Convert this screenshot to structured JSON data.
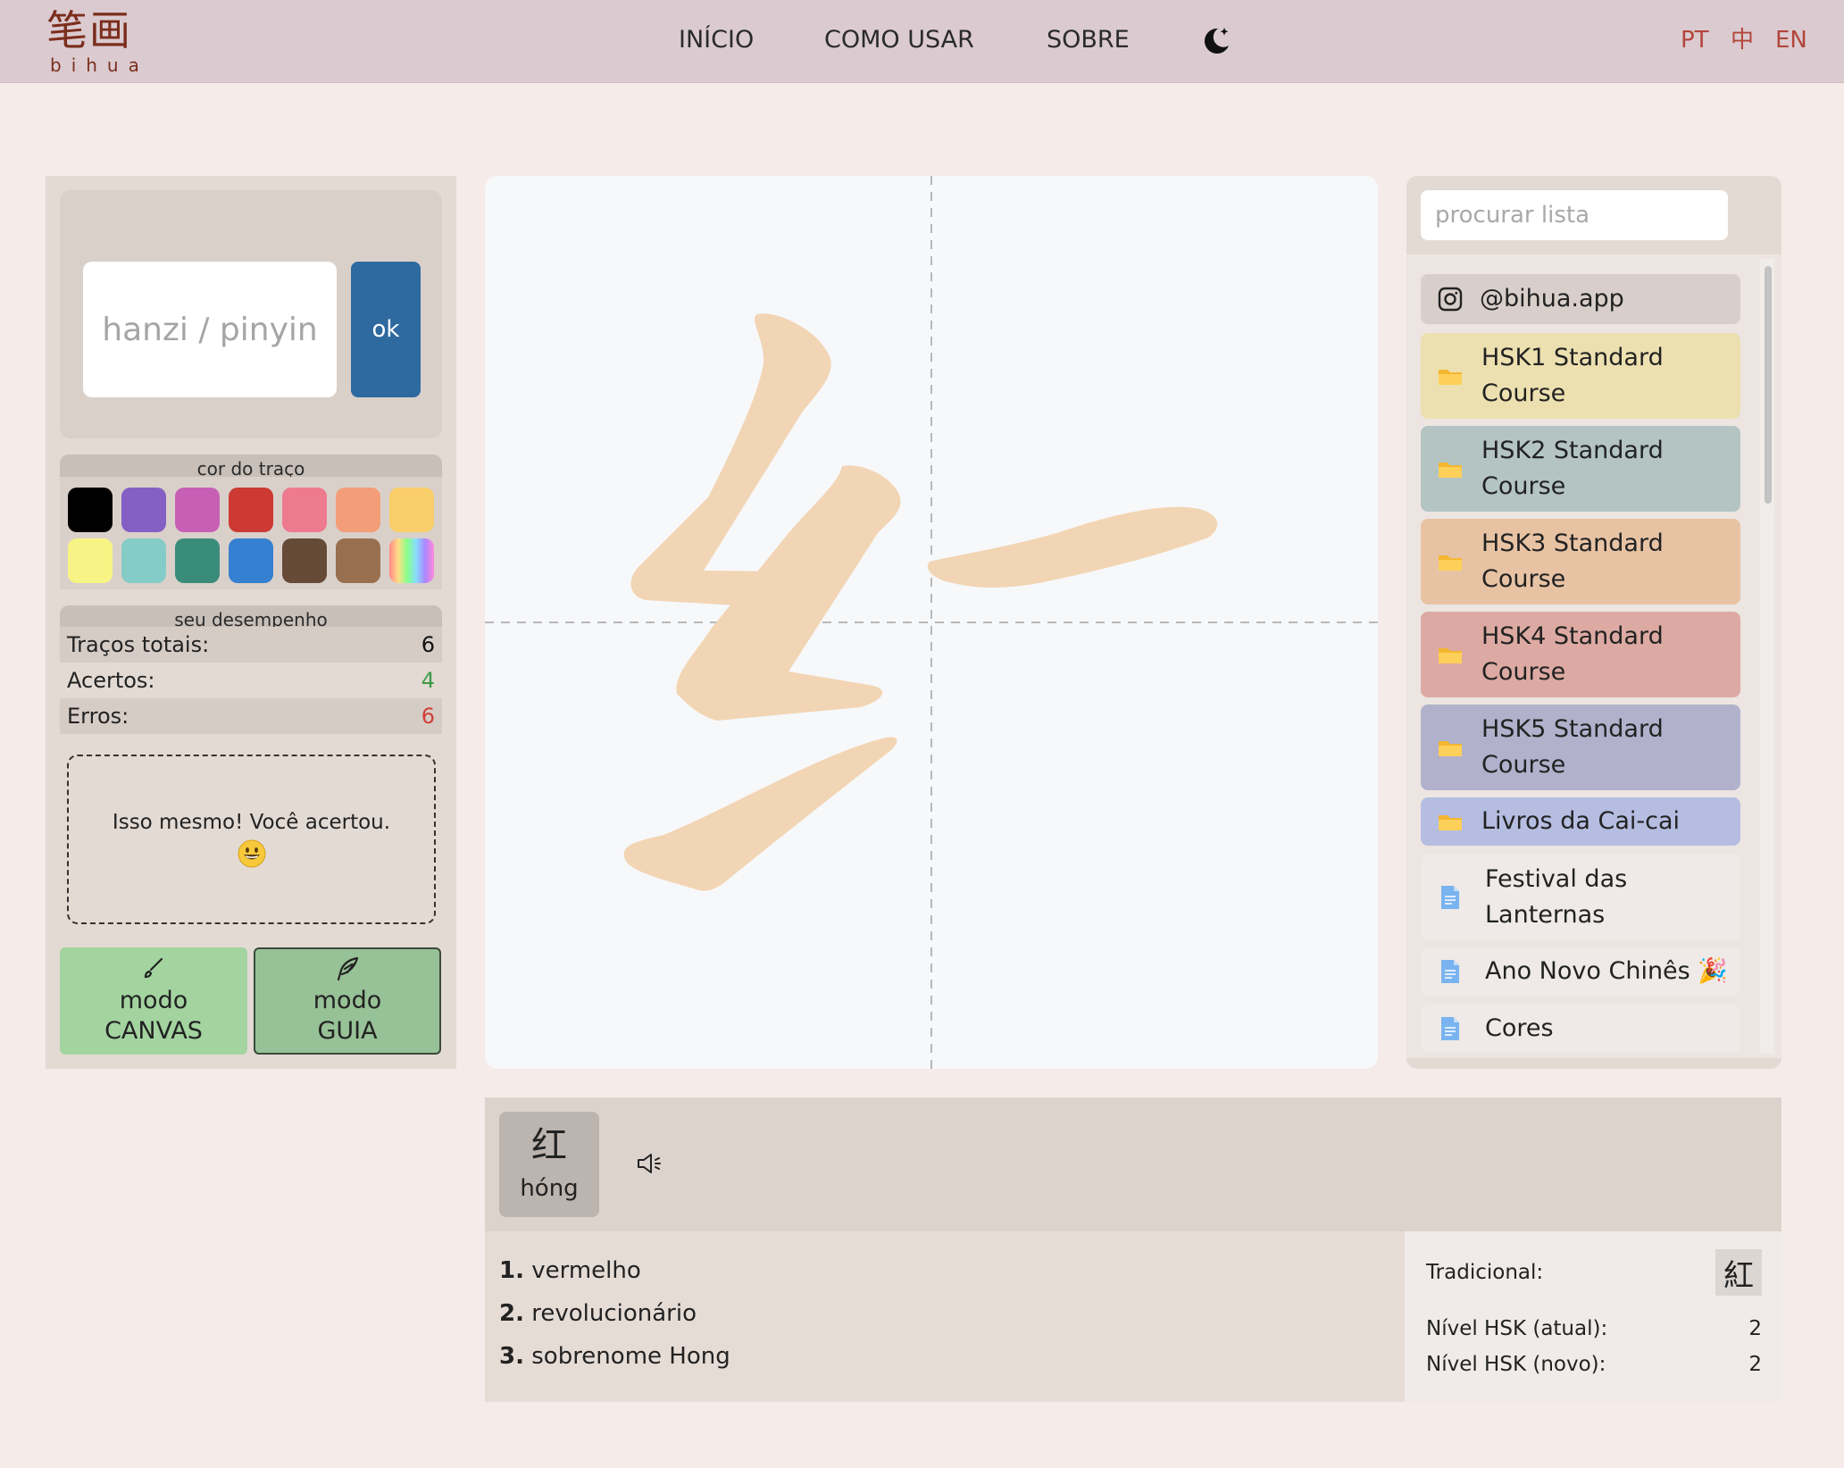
{
  "header": {
    "logo_cn": "笔画",
    "logo_en": "bihua",
    "nav": [
      "INÍCIO",
      "COMO USAR",
      "SOBRE"
    ],
    "languages": [
      "PT",
      "中",
      "EN"
    ],
    "accent_color": "#b2463a"
  },
  "left_panel": {
    "input_placeholder": "hanzi / pinyin",
    "ok_label": "ok",
    "stroke_color_title": "cor do traço",
    "swatches": [
      "#000000",
      "#8460c4",
      "#c760b5",
      "#cc3a33",
      "#ee7a90",
      "#f39e78",
      "#f8cd6a",
      "#f7f485",
      "#85cbc7",
      "#3a8c7a",
      "#3580d0",
      "#664a38",
      "#987050",
      "rainbow"
    ],
    "performance_title": "seu desempenho",
    "stats": {
      "total_label": "Traços totais:",
      "total_value": "6",
      "correct_label": "Acertos:",
      "correct_value": "4",
      "errors_label": "Erros:",
      "errors_value": "6"
    },
    "feedback": "Isso mesmo! Você acertou.",
    "mode_canvas": {
      "line1": "modo",
      "line2": "CANVAS"
    },
    "mode_guide": {
      "line1": "modo",
      "line2": "GUIA"
    }
  },
  "canvas": {
    "stroke_color": "#f2d5b4",
    "strokes_drawn": 4
  },
  "right_panel": {
    "search_placeholder": "procurar lista",
    "items": [
      {
        "label": "@bihua.app",
        "icon": "instagram-icon",
        "color": "#d9cfca"
      },
      {
        "label": "HSK1 Standard Course",
        "icon": "folder-icon",
        "color": "#ede0b0"
      },
      {
        "label": "HSK2 Standard Course",
        "icon": "folder-icon",
        "color": "#b3c4c3"
      },
      {
        "label": "HSK3 Standard Course",
        "icon": "folder-icon",
        "color": "#e7c3a4"
      },
      {
        "label": "HSK4 Standard Course",
        "icon": "folder-icon",
        "color": "#dcaaa3"
      },
      {
        "label": "HSK5 Standard Course",
        "icon": "folder-icon",
        "color": "#b1b1cc"
      },
      {
        "label": "Livros da Cai-cai",
        "icon": "folder-icon",
        "color": "#b5bde1"
      },
      {
        "label": "Festival das Lanternas",
        "icon": "document-icon",
        "color": "#efeae7"
      },
      {
        "label": "Ano Novo Chinês 🎉",
        "icon": "document-icon",
        "color": "#efeae7"
      },
      {
        "label": "Cores",
        "icon": "document-icon",
        "color": "#efeae7"
      }
    ]
  },
  "word": {
    "hanzi": "红",
    "pinyin": "hóng",
    "definitions": [
      "vermelho",
      "revolucionário",
      "sobrenome Hong"
    ],
    "definition_numbers": [
      "1.",
      "2.",
      "3."
    ],
    "traditional_label": "Tradicional:",
    "traditional_value": "紅",
    "hsk_current_label": "Nível HSK (atual):",
    "hsk_current_value": "2",
    "hsk_new_label": "Nível HSK (novo):",
    "hsk_new_value": "2"
  }
}
